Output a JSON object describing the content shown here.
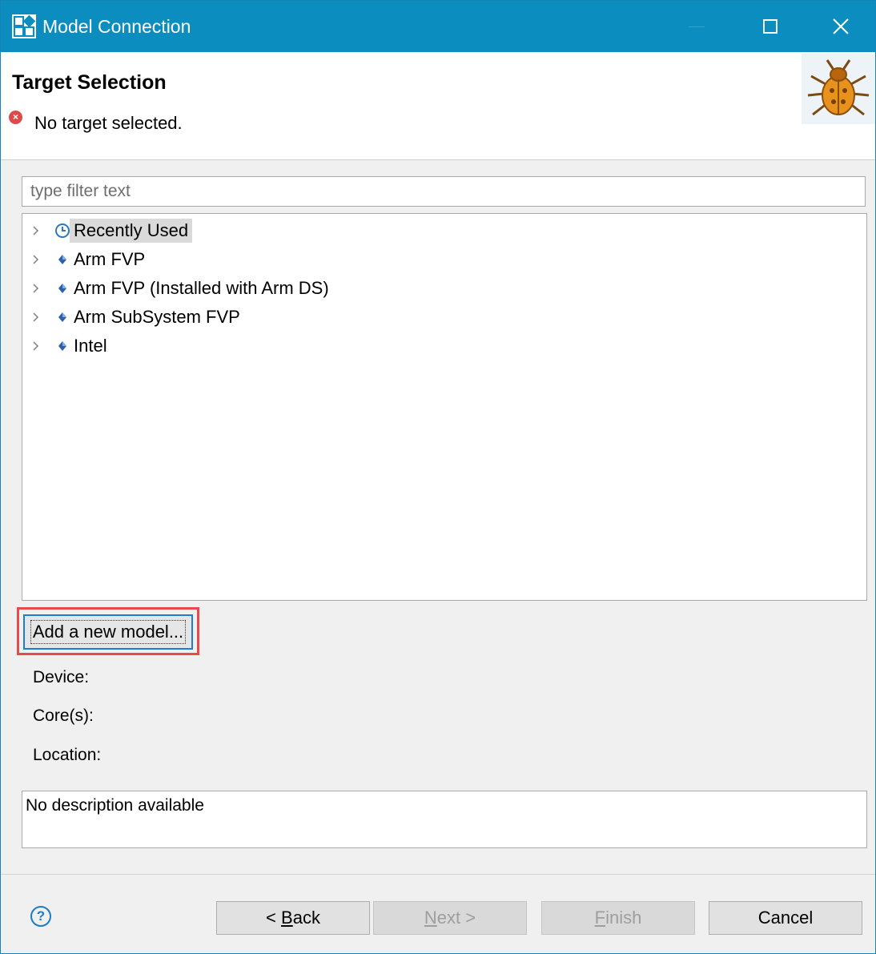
{
  "window": {
    "title": "Model Connection",
    "controls": [
      "minimize-icon",
      "maximize-icon",
      "close-icon"
    ]
  },
  "header": {
    "title": "Target Selection",
    "message": "No target selected.",
    "message_icon": "error-icon",
    "banner_icon": "bug-icon"
  },
  "filter": {
    "placeholder": "type filter text",
    "value": ""
  },
  "tree": {
    "items": [
      {
        "label": "Recently Used",
        "icon": "clock-icon",
        "selected": true
      },
      {
        "label": "Arm FVP",
        "icon": "diamond-icon"
      },
      {
        "label": "Arm FVP (Installed with Arm DS)",
        "icon": "diamond-icon"
      },
      {
        "label": "Arm SubSystem FVP",
        "icon": "diamond-icon"
      },
      {
        "label": "Intel",
        "icon": "diamond-icon"
      }
    ]
  },
  "add_model": {
    "label": "Add a new model..."
  },
  "info": {
    "device_label": "Device:",
    "cores_label": "Core(s):",
    "location_label": "Location:"
  },
  "description": {
    "text": "No description available"
  },
  "footer": {
    "help_icon": "help-icon",
    "back": {
      "prefix": "< ",
      "mnemonic": "B",
      "rest": "ack",
      "enabled": true
    },
    "next": {
      "mnemonic": "N",
      "rest": "ext >",
      "enabled": false
    },
    "finish": {
      "mnemonic": "F",
      "rest": "inish",
      "enabled": false
    },
    "cancel": {
      "label": "Cancel",
      "enabled": true
    }
  },
  "colors": {
    "titlebar": "#0b8ebf",
    "error": "#dd4a4a",
    "highlight_frame": "#e64a4a",
    "focus": "#1a7fcf"
  }
}
